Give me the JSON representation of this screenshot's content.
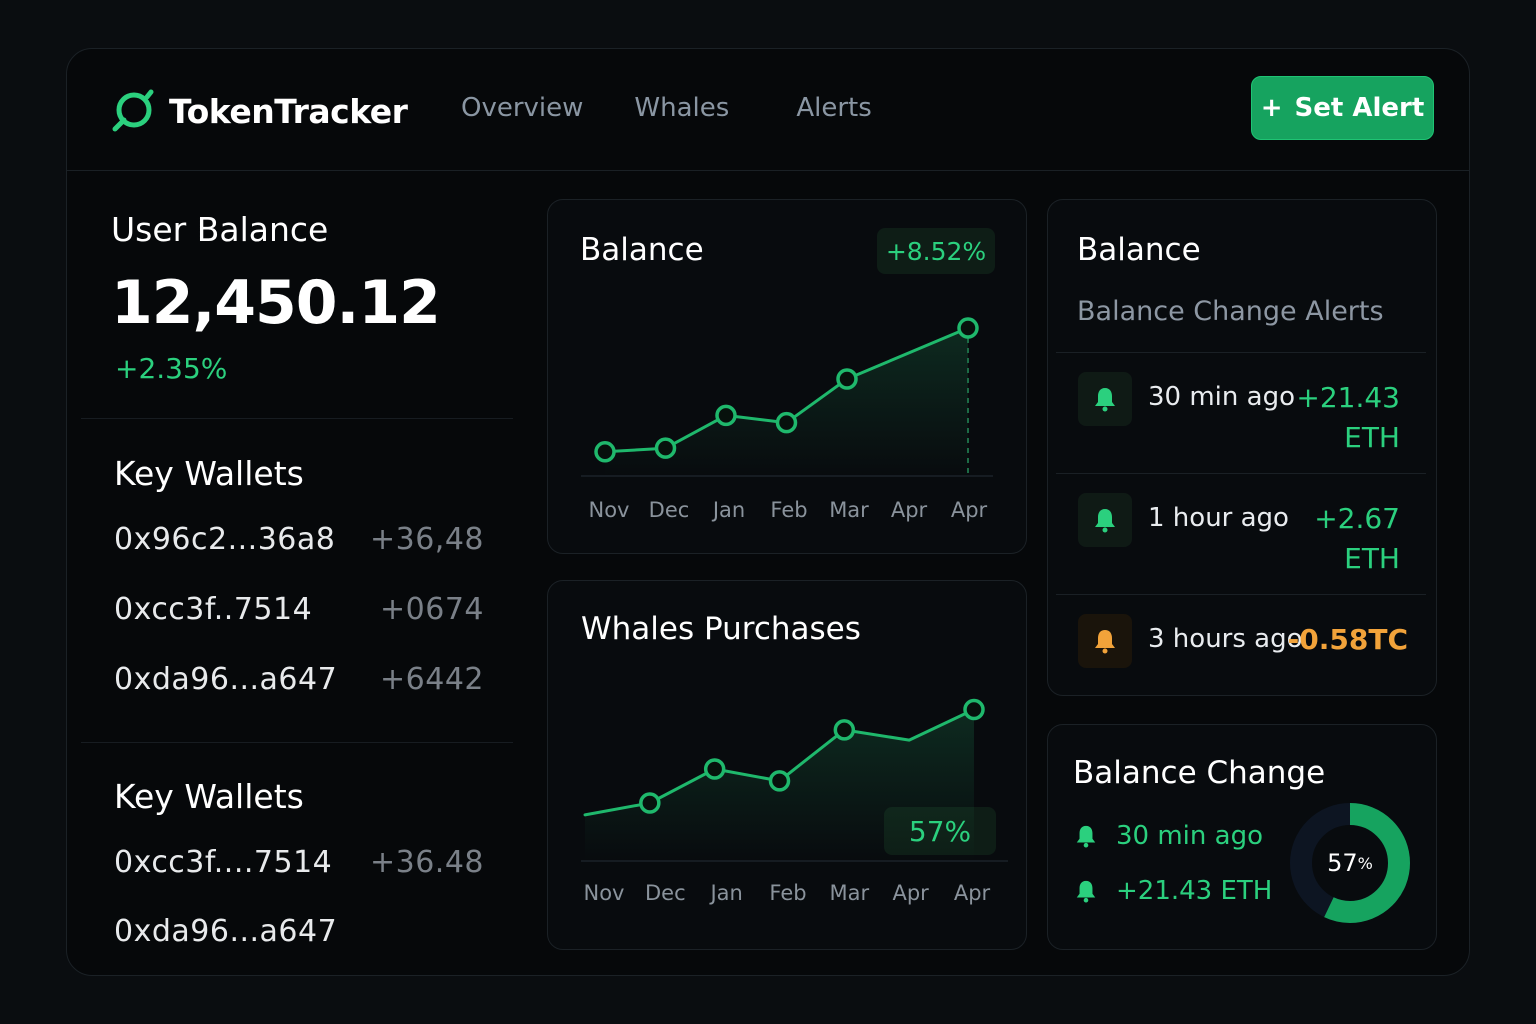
{
  "header": {
    "brand": "TokenTracker",
    "nav": [
      "Overview",
      "Whales",
      "Alerts"
    ],
    "set_alert": "Set Alert",
    "set_alert_icon": "+"
  },
  "user_balance": {
    "title": "User Balance",
    "value": "12,450.12",
    "change": "+2.35%"
  },
  "key_wallets_1": {
    "title": "Key Wallets",
    "rows": [
      {
        "address": "0x96c2...36a8",
        "value": "+36,48"
      },
      {
        "address": "0xcc3f..7514",
        "value": "+0674"
      },
      {
        "address": "0xda96...a647",
        "value": "+6442"
      }
    ]
  },
  "key_wallets_2": {
    "title": "Key Wallets",
    "rows": [
      {
        "address": "0xcc3f....7514",
        "value": "+36.48"
      },
      {
        "address": "0xda96...a647",
        "value": ""
      }
    ]
  },
  "balance_chart": {
    "title": "Balance",
    "badge": "+8.52%"
  },
  "whales_chart": {
    "title": "Whales Purchases",
    "badge": "57%"
  },
  "alerts": {
    "title": "Balance",
    "subtitle": "Balance Change Alerts",
    "items": [
      {
        "time": "30 min ago",
        "amount_line1": "+21.43",
        "amount_line2": "ETH",
        "icon": "bell-icon",
        "tone": "positive"
      },
      {
        "time": "1 hour ago",
        "amount_line1": "+2.67",
        "amount_line2": "ETH",
        "icon": "bell-icon",
        "tone": "positive"
      },
      {
        "time": "3 hours ago",
        "amount_line1": "-0.58TC",
        "amount_line2": "",
        "icon": "bell-icon",
        "tone": "negative"
      }
    ]
  },
  "balance_change": {
    "title": "Balance Change",
    "line1": "30 min ago",
    "line2": "+21.43 ETH",
    "donut_value": "57",
    "donut_unit": "%",
    "donut_fraction": 0.57
  },
  "colors": {
    "accent": "#2bd07e",
    "accent_dark": "#16a35f",
    "warning": "#f2a33a",
    "background": "#06080a"
  },
  "chart_data": [
    {
      "type": "line",
      "title": "Balance",
      "categories": [
        "Nov",
        "Dec",
        "Jan",
        "Feb",
        "Mar",
        "Apr",
        "Apr"
      ],
      "series": [
        {
          "values": [
            10,
            12,
            30,
            26,
            50,
            null,
            78
          ]
        }
      ],
      "ylim": [
        0,
        100
      ],
      "grid": false,
      "markers": true,
      "area_fill": true,
      "annotation": "+8.52%"
    },
    {
      "type": "line",
      "title": "Whales Purchases",
      "categories": [
        "Nov",
        "Dec",
        "Jan",
        "Feb",
        "Mar",
        "Apr",
        "Apr"
      ],
      "series": [
        {
          "values": [
            13,
            20,
            40,
            33,
            63,
            57,
            75
          ]
        }
      ],
      "ylim": [
        0,
        100
      ],
      "grid": false,
      "markers": true,
      "area_fill": true,
      "annotation": "57%"
    }
  ]
}
